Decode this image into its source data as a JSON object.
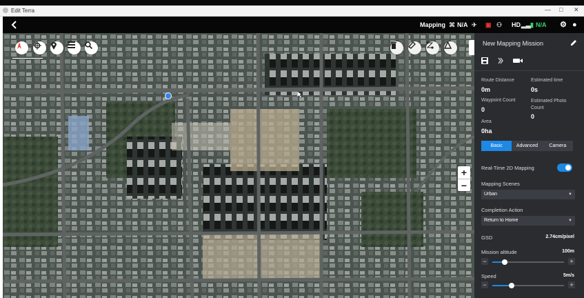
{
  "window": {
    "title": "Edit Terra",
    "min_glyph": "—",
    "max_glyph": "□",
    "close_glyph": "✕"
  },
  "appbar": {
    "mode": "Mapping",
    "rtk_status": "N/A",
    "hd_label": "HD",
    "battery_status": "N/A",
    "colors": {
      "ok": "#3ad06b",
      "warn": "#e33333"
    }
  },
  "map": {
    "tools_left": [
      "compass-icon",
      "locate-icon",
      "pin-icon",
      "menu-icon",
      "search-icon"
    ],
    "tools_right": [
      "trash-icon",
      "erase-icon",
      "route-icon",
      "polygon-icon"
    ],
    "zoom_in": "+",
    "zoom_out": "−"
  },
  "panel": {
    "title": "New Mapping Mission",
    "stats": {
      "route_distance_label": "Route Distance",
      "route_distance_value": "0m",
      "estimated_time_label": "Estimated time",
      "estimated_time_value": "0s",
      "waypoint_count_label": "Waypoint Count",
      "waypoint_count_value": "0",
      "estimated_photo_label": "Estimated Photo Count",
      "estimated_photo_value": "0",
      "area_label": "Area",
      "area_value": "0ha"
    },
    "tabs": [
      {
        "label": "Basic",
        "active": true
      },
      {
        "label": "Advanced",
        "active": false
      },
      {
        "label": "Camera",
        "active": false
      }
    ],
    "realtime_label": "Real-Time 2D Mapping",
    "realtime_on": true,
    "scenes_label": "Mapping Scenes",
    "scenes_value": "Urban",
    "completion_label": "Completion Action",
    "completion_value": "Return to Home",
    "gsd_label": "GSD",
    "gsd_value": "2.74cm/pixel",
    "altitude_label": "Mission altitude",
    "altitude_value": "100m",
    "altitude_fraction": 0.17,
    "speed_label": "Speed",
    "speed_value": "5m/s",
    "speed_fraction": 0.27,
    "minus": "−",
    "plus": "+"
  }
}
